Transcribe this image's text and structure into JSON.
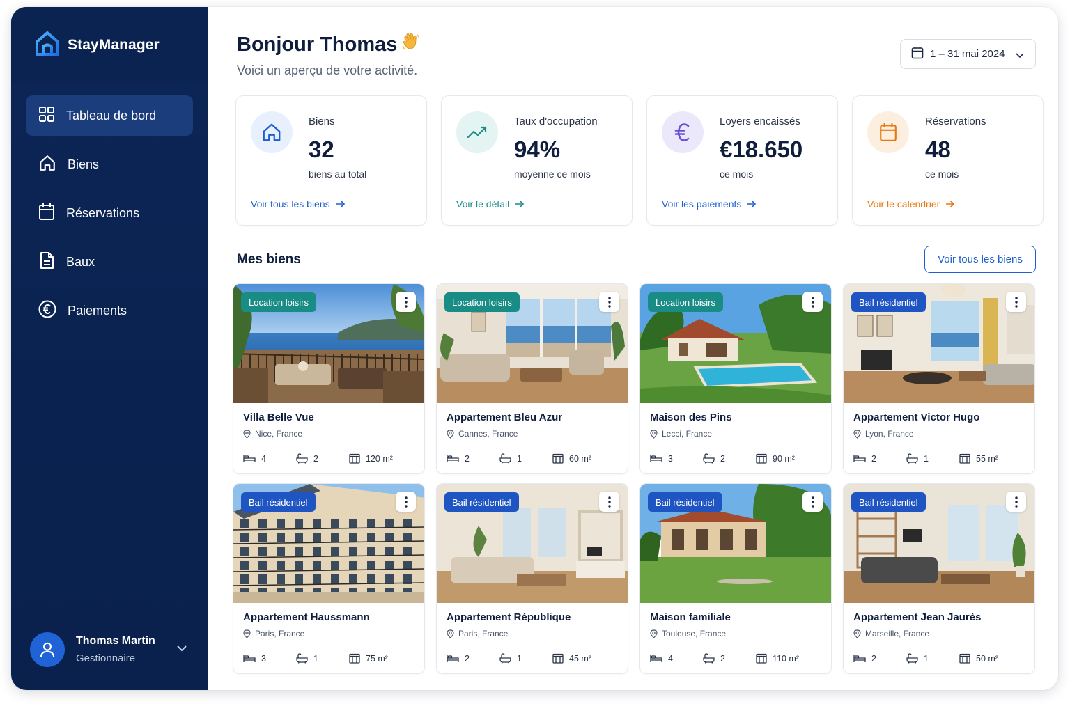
{
  "brand": {
    "name": "StayManager"
  },
  "sidebar": {
    "items": [
      {
        "label": "Tableau de bord",
        "icon": "dashboard-grid-icon",
        "active": true
      },
      {
        "label": "Biens",
        "icon": "home-icon",
        "active": false
      },
      {
        "label": "Réservations",
        "icon": "calendar-icon",
        "active": false
      },
      {
        "label": "Baux",
        "icon": "document-icon",
        "active": false
      },
      {
        "label": "Paiements",
        "icon": "euro-coin-icon",
        "active": false
      }
    ],
    "user": {
      "name": "Thomas Martin",
      "role": "Gestionnaire"
    }
  },
  "header": {
    "greeting": "Bonjour Thomas",
    "greeting_emoji": "👋",
    "subtitle": "Voici un aperçu de votre activité.",
    "date_range": "1 – 31 mai 2024"
  },
  "stats": [
    {
      "label": "Biens",
      "value": "32",
      "sub": "biens au total",
      "link": "Voir tous les biens",
      "icon": "home-icon",
      "color": "#1d5fd0",
      "bg": "#e8f0fd"
    },
    {
      "label": "Taux d'occupation",
      "value": "94%",
      "sub": "moyenne ce mois",
      "link": "Voir le détail",
      "icon": "trend-up-icon",
      "color": "#1a8c86",
      "bg": "#e4f4f2"
    },
    {
      "label": "Loyers encaissés",
      "value": "€18.650",
      "sub": "ce mois",
      "link": "Voir les paiements",
      "icon": "euro-icon",
      "color": "#6b4fd8",
      "bg": "#ece8fb"
    },
    {
      "label": "Réservations",
      "value": "48",
      "sub": "ce mois",
      "link": "Voir le calendrier",
      "icon": "calendar-icon",
      "color": "#e8780f",
      "bg": "#fdefe0"
    }
  ],
  "properties_section": {
    "title": "Mes biens",
    "view_all": "Voir tous les biens"
  },
  "properties": [
    {
      "badge": "Location loisirs",
      "type": "leisure",
      "name": "Villa Belle Vue",
      "location": "Nice, France",
      "beds": "4",
      "baths": "2",
      "area": "120 m²",
      "photo": "terrace-sea"
    },
    {
      "badge": "Location loisirs",
      "type": "leisure",
      "name": "Appartement Bleu Azur",
      "location": "Cannes, France",
      "beds": "2",
      "baths": "1",
      "area": "60 m²",
      "photo": "living-sea"
    },
    {
      "badge": "Location loisirs",
      "type": "leisure",
      "name": "Maison des Pins",
      "location": "Lecci, France",
      "beds": "3",
      "baths": "2",
      "area": "90 m²",
      "photo": "house-pool"
    },
    {
      "badge": "Bail résidentiel",
      "type": "resid",
      "name": "Appartement Victor Hugo",
      "location": "Lyon, France",
      "beds": "2",
      "baths": "1",
      "area": "55 m²",
      "photo": "interior-bright"
    },
    {
      "badge": "Bail résidentiel",
      "type": "resid",
      "name": "Appartement Haussmann",
      "location": "Paris, France",
      "beds": "3",
      "baths": "1",
      "area": "75 m²",
      "photo": "haussmann"
    },
    {
      "badge": "Bail résidentiel",
      "type": "resid",
      "name": "Appartement République",
      "location": "Paris, France",
      "beds": "2",
      "baths": "1",
      "area": "45 m²",
      "photo": "interior-beige"
    },
    {
      "badge": "Bail résidentiel",
      "type": "resid",
      "name": "Maison familiale",
      "location": "Toulouse, France",
      "beds": "4",
      "baths": "2",
      "area": "110 m²",
      "photo": "house-garden"
    },
    {
      "badge": "Bail résidentiel",
      "type": "resid",
      "name": "Appartement Jean Jaurès",
      "location": "Marseille, France",
      "beds": "2",
      "baths": "1",
      "area": "50 m²",
      "photo": "interior-wood"
    }
  ]
}
